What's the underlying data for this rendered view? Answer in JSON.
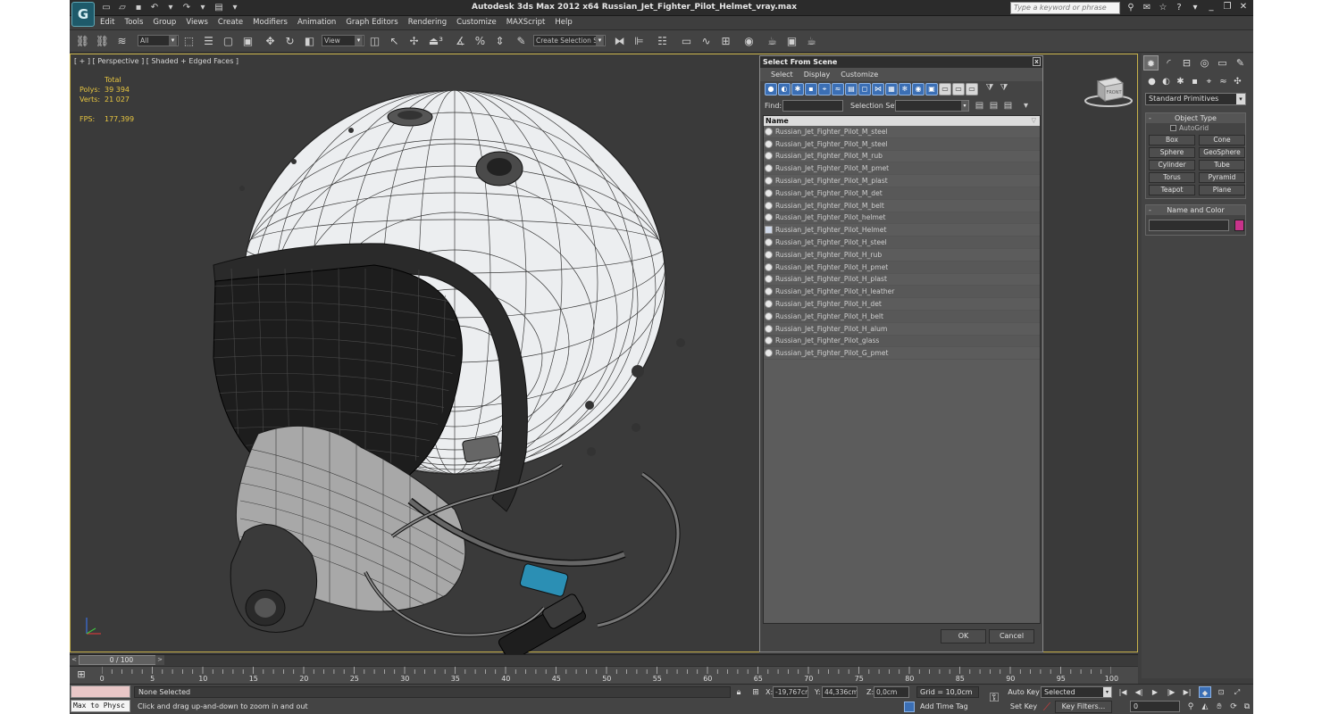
{
  "window": {
    "title": "Autodesk 3ds Max  2012 x64      Russian_Jet_Fighter_Pilot_Helmet_vray.max",
    "search_placeholder": "Type a keyword or phrase",
    "logo_glyph": "G"
  },
  "menu": [
    "Edit",
    "Tools",
    "Group",
    "Views",
    "Create",
    "Modifiers",
    "Animation",
    "Graph Editors",
    "Rendering",
    "Customize",
    "MAXScript",
    "Help"
  ],
  "toolbar": {
    "filter_value": "All",
    "refcoord_value": "View",
    "named_selection_value": "Create Selection Se"
  },
  "viewport": {
    "label": "[ + ] [ Perspective ] [ Shaded + Edged Faces ]",
    "stats": {
      "total_label": "Total",
      "polys_label": "Polys:",
      "polys_value": "39 394",
      "verts_label": "Verts:",
      "verts_value": "21 027",
      "fps_label": "FPS:",
      "fps_value": "177,399"
    },
    "viewcube_text": "FRONT",
    "accent_color": "#c8b24a"
  },
  "dialog": {
    "title": "Select From Scene",
    "close_glyph": "x",
    "menu": [
      "Select",
      "Display",
      "Customize"
    ],
    "find_label": "Find:",
    "selection_set_label": "Selection Set:",
    "column_name": "Name",
    "objects": [
      {
        "name": "Russian_Jet_Fighter_Pilot_M_steel",
        "type": "geometry"
      },
      {
        "name": "Russian_Jet_Fighter_Pilot_M_steel",
        "type": "geometry"
      },
      {
        "name": "Russian_Jet_Fighter_Pilot_M_rub",
        "type": "geometry"
      },
      {
        "name": "Russian_Jet_Fighter_Pilot_M_pmet",
        "type": "geometry"
      },
      {
        "name": "Russian_Jet_Fighter_Pilot_M_plast",
        "type": "geometry"
      },
      {
        "name": "Russian_Jet_Fighter_Pilot_M_det",
        "type": "geometry"
      },
      {
        "name": "Russian_Jet_Fighter_Pilot_M_belt",
        "type": "geometry"
      },
      {
        "name": "Russian_Jet_Fighter_Pilot_helmet",
        "type": "geometry"
      },
      {
        "name": "Russian_Jet_Fighter_Pilot_Helmet",
        "type": "group"
      },
      {
        "name": "Russian_Jet_Fighter_Pilot_H_steel",
        "type": "geometry"
      },
      {
        "name": "Russian_Jet_Fighter_Pilot_H_rub",
        "type": "geometry"
      },
      {
        "name": "Russian_Jet_Fighter_Pilot_H_pmet",
        "type": "geometry"
      },
      {
        "name": "Russian_Jet_Fighter_Pilot_H_plast",
        "type": "geometry"
      },
      {
        "name": "Russian_Jet_Fighter_Pilot_H_leather",
        "type": "geometry"
      },
      {
        "name": "Russian_Jet_Fighter_Pilot_H_det",
        "type": "geometry"
      },
      {
        "name": "Russian_Jet_Fighter_Pilot_H_belt",
        "type": "geometry"
      },
      {
        "name": "Russian_Jet_Fighter_Pilot_H_alum",
        "type": "geometry"
      },
      {
        "name": "Russian_Jet_Fighter_Pilot_glass",
        "type": "geometry"
      },
      {
        "name": "Russian_Jet_Fighter_Pilot_G_pmet",
        "type": "geometry"
      }
    ],
    "ok_label": "OK",
    "cancel_label": "Cancel"
  },
  "command_panel": {
    "category_value": "Standard Primitives",
    "object_type_title": "Object Type",
    "autogrid_label": "AutoGrid",
    "primitives": [
      "Box",
      "Cone",
      "Sphere",
      "GeoSphere",
      "Cylinder",
      "Tube",
      "Torus",
      "Pyramid",
      "Teapot",
      "Plane"
    ],
    "name_color_title": "Name and Color",
    "object_color": "#c8338a"
  },
  "timeline": {
    "slider_text": "0 / 100",
    "prev_glyph": "<",
    "next_glyph": ">",
    "tick_labels": [
      "0",
      "5",
      "10",
      "15",
      "20",
      "25",
      "30",
      "35",
      "40",
      "45",
      "50",
      "55",
      "60",
      "65",
      "70",
      "75",
      "80",
      "85",
      "90",
      "95",
      "100"
    ]
  },
  "status": {
    "maxscript_text": "Max to Physc",
    "selection_text": "None Selected",
    "prompt_text": "Click and drag up-and-down to zoom in and out",
    "x_label": "X:",
    "x_value": "-19,767cm",
    "y_label": "Y:",
    "y_value": "44,336cm",
    "z_label": "Z:",
    "z_value": "0,0cm",
    "grid_text": "Grid = 10,0cm",
    "add_time_tag": "Add Time Tag",
    "auto_key": "Auto Key",
    "set_key": "Set Key",
    "selected_value": "Selected",
    "key_filters": "Key Filters...",
    "frame_value": "0"
  }
}
